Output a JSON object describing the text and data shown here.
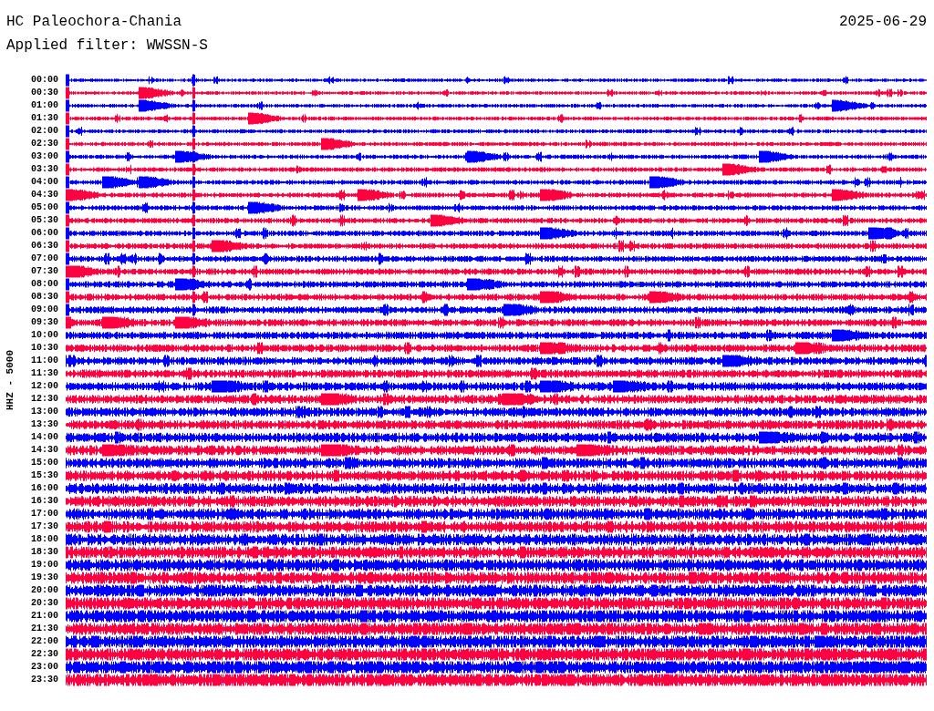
{
  "header": {
    "station": "HC Paleochora-Chania",
    "filter": "Applied filter: WWSSN-S",
    "date": "2025-06-29"
  },
  "channel_label": "HHZ - 5000",
  "traces": [
    {
      "time": "00:00",
      "color": "#0000ff"
    },
    {
      "time": "00:30",
      "color": "#ff0040"
    },
    {
      "time": "01:00",
      "color": "#0000ff"
    },
    {
      "time": "01:30",
      "color": "#ff0040"
    },
    {
      "time": "02:00",
      "color": "#0000ff"
    },
    {
      "time": "02:30",
      "color": "#ff0040"
    },
    {
      "time": "03:00",
      "color": "#0000ff"
    },
    {
      "time": "03:30",
      "color": "#ff0040"
    },
    {
      "time": "04:00",
      "color": "#0000ff"
    },
    {
      "time": "04:30",
      "color": "#ff0040"
    },
    {
      "time": "05:00",
      "color": "#0000ff"
    },
    {
      "time": "05:30",
      "color": "#ff0040"
    },
    {
      "time": "06:00",
      "color": "#0000ff"
    },
    {
      "time": "06:30",
      "color": "#ff0040"
    },
    {
      "time": "07:00",
      "color": "#0000ff"
    },
    {
      "time": "07:30",
      "color": "#ff0040"
    },
    {
      "time": "08:00",
      "color": "#0000ff"
    },
    {
      "time": "08:30",
      "color": "#ff0040"
    },
    {
      "time": "09:00",
      "color": "#0000ff"
    },
    {
      "time": "09:30",
      "color": "#ff0040"
    },
    {
      "time": "10:00",
      "color": "#0000ff"
    },
    {
      "time": "10:30",
      "color": "#ff0040"
    },
    {
      "time": "11:00",
      "color": "#0000ff"
    },
    {
      "time": "11:30",
      "color": "#ff0040"
    },
    {
      "time": "12:00",
      "color": "#0000ff"
    },
    {
      "time": "12:30",
      "color": "#ff0040"
    },
    {
      "time": "13:00",
      "color": "#0000ff"
    },
    {
      "time": "13:30",
      "color": "#ff0040"
    },
    {
      "time": "14:00",
      "color": "#0000ff"
    },
    {
      "time": "14:30",
      "color": "#ff0040"
    },
    {
      "time": "15:00",
      "color": "#0000ff"
    },
    {
      "time": "15:30",
      "color": "#ff0040"
    },
    {
      "time": "16:00",
      "color": "#0000ff"
    },
    {
      "time": "16:30",
      "color": "#ff0040"
    },
    {
      "time": "17:00",
      "color": "#0000ff"
    },
    {
      "time": "17:30",
      "color": "#ff0040"
    },
    {
      "time": "18:00",
      "color": "#0000ff"
    },
    {
      "time": "18:30",
      "color": "#ff0040"
    },
    {
      "time": "19:00",
      "color": "#0000ff"
    },
    {
      "time": "19:30",
      "color": "#ff0040"
    },
    {
      "time": "20:00",
      "color": "#0000ff"
    },
    {
      "time": "20:30",
      "color": "#ff0040"
    },
    {
      "time": "21:00",
      "color": "#0000ff"
    },
    {
      "time": "21:30",
      "color": "#ff0040"
    },
    {
      "time": "22:00",
      "color": "#0000ff"
    },
    {
      "time": "22:30",
      "color": "#ff0040"
    },
    {
      "time": "23:00",
      "color": "#0000ff"
    },
    {
      "time": "23:30",
      "color": "#ff0040"
    }
  ]
}
